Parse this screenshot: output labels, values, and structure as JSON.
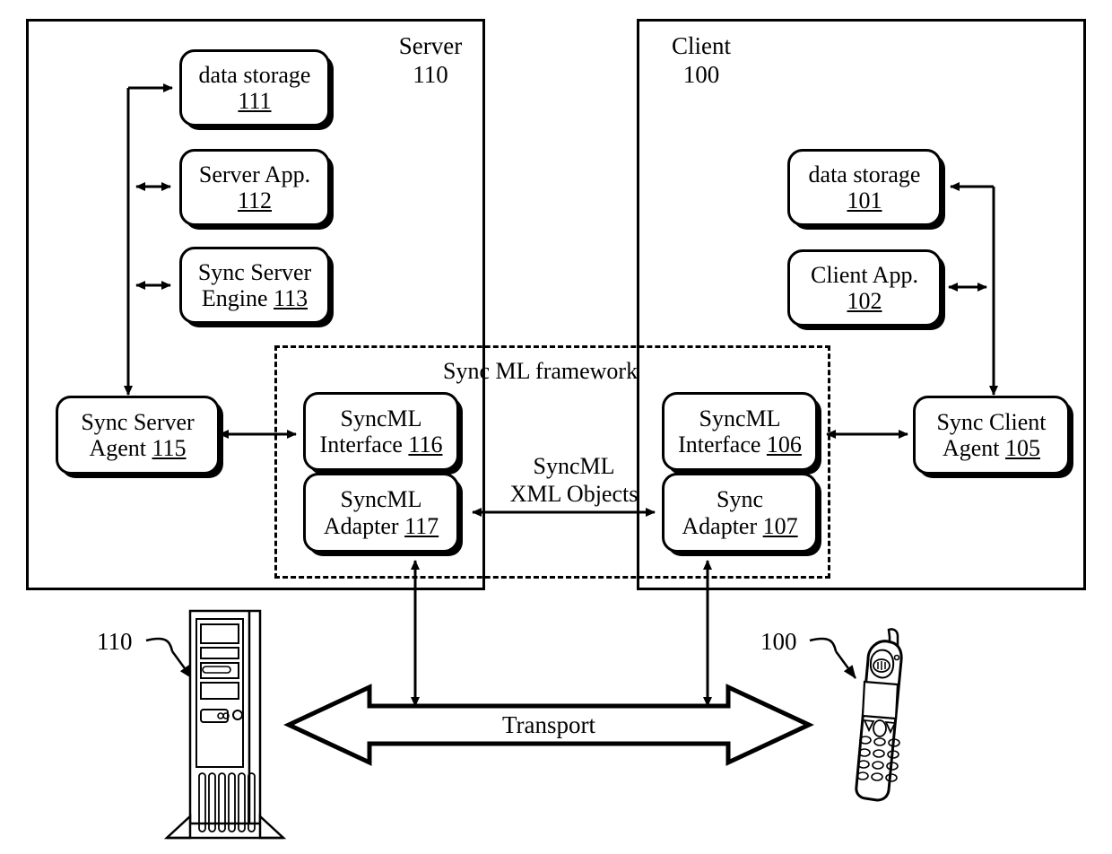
{
  "figure": {
    "type": "patent-block-diagram",
    "title": "SyncML synchronization framework between Server and Client"
  },
  "containers": [
    {
      "name": "server",
      "label": "Server\n110"
    },
    {
      "name": "client",
      "label": "Client\n100"
    }
  ],
  "framework": {
    "label": "Sync ML framework"
  },
  "nodes": {
    "server_data_storage": {
      "line1": "data storage",
      "line2": "111"
    },
    "server_app": {
      "line1": "Server App.",
      "line2": "112"
    },
    "sync_server_engine": {
      "line1": "Sync Server",
      "line2": "Engine 113"
    },
    "sync_server_agent": {
      "line1": "Sync Server",
      "line2": "Agent 115"
    },
    "syncml_interface_116": {
      "line1": "SyncML",
      "line2": "Interface 116"
    },
    "syncml_adapter_117": {
      "line1": "SyncML",
      "line2": "Adapter 117"
    },
    "syncml_interface_106": {
      "line1": "SyncML",
      "line2": "Interface 106"
    },
    "sync_adapter_107": {
      "line1": "Sync",
      "line2": "Adapter 107"
    },
    "sync_client_agent": {
      "line1": "Sync Client",
      "line2": "Agent 105"
    },
    "client_data_storage": {
      "line1": "data storage",
      "line2": "101"
    },
    "client_app": {
      "line1": "Client App.",
      "line2": "102"
    }
  },
  "labels": {
    "syncml_xml_objects": "SyncML\nXML Objects",
    "transport": "Transport",
    "server_ref": "110",
    "client_ref": "100"
  },
  "icons": {
    "server_tower": "server-tower-icon",
    "mobile_phone": "mobile-phone-icon",
    "transport_double_arrow": "double-headed-arrow-icon"
  },
  "colors": {
    "stroke": "#000000",
    "background": "#ffffff"
  }
}
